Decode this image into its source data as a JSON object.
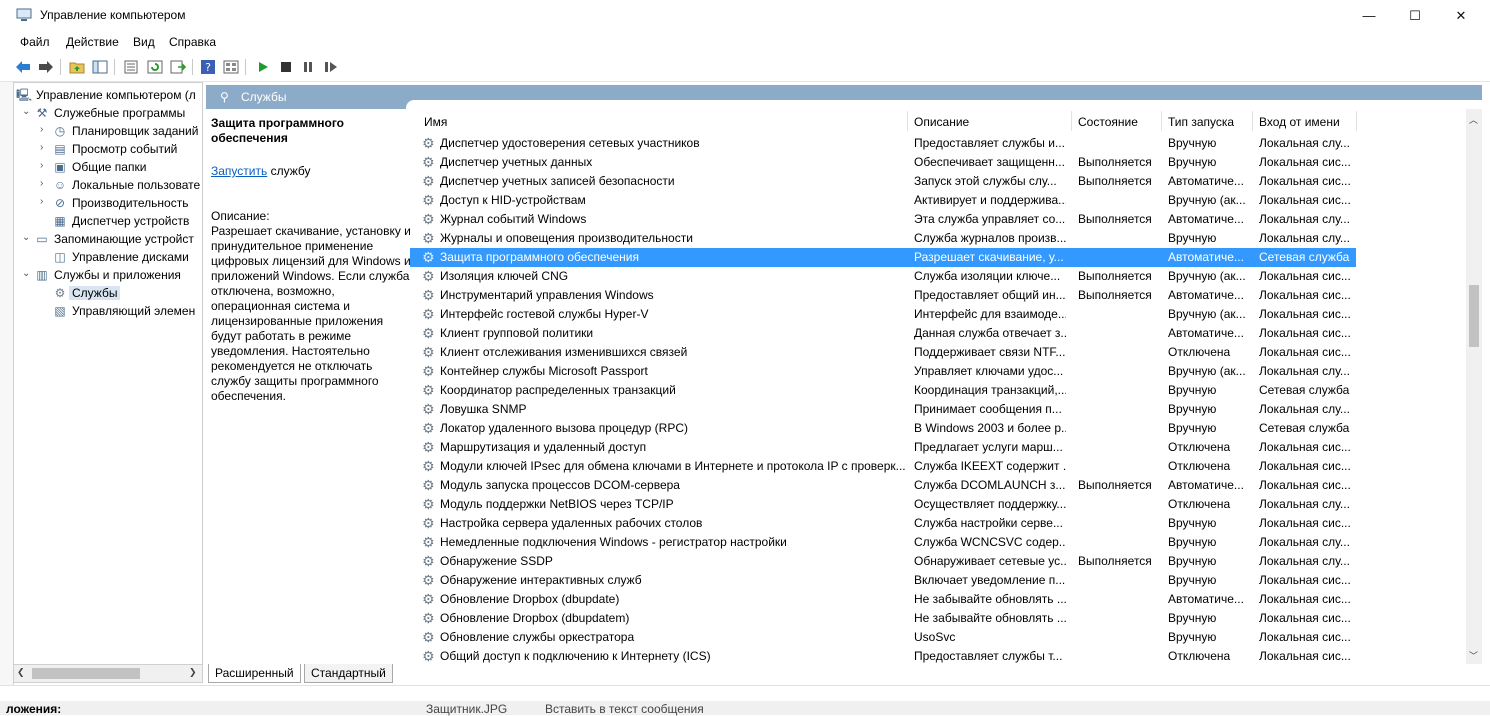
{
  "window": {
    "title": "Управление компьютером",
    "controls": {
      "minimize": "—",
      "maximize": "☐",
      "close": "✕"
    }
  },
  "menu": [
    {
      "label": "Файл"
    },
    {
      "label": "Действие"
    },
    {
      "label": "Вид"
    },
    {
      "label": "Справка"
    }
  ],
  "tree": [
    {
      "label": "Управление компьютером (л",
      "icon": "computer-icon",
      "level": 0,
      "exp": ""
    },
    {
      "label": "Служебные программы",
      "icon": "tools-icon",
      "level": 1,
      "exp": "⌄"
    },
    {
      "label": "Планировщик заданий",
      "icon": "clock-icon",
      "level": 2,
      "exp": "›"
    },
    {
      "label": "Просмотр событий",
      "icon": "event-viewer-icon",
      "level": 2,
      "exp": "›"
    },
    {
      "label": "Общие папки",
      "icon": "shared-folder-icon",
      "level": 2,
      "exp": "›"
    },
    {
      "label": "Локальные пользовате",
      "icon": "users-icon",
      "level": 2,
      "exp": "›"
    },
    {
      "label": "Производительность",
      "icon": "performance-icon",
      "level": 2,
      "exp": "›"
    },
    {
      "label": "Диспетчер устройств",
      "icon": "device-manager-icon",
      "level": 2,
      "exp": ""
    },
    {
      "label": "Запоминающие устройст",
      "icon": "storage-icon",
      "level": 1,
      "exp": "⌄"
    },
    {
      "label": "Управление дисками",
      "icon": "disk-icon",
      "level": 2,
      "exp": ""
    },
    {
      "label": "Службы и приложения",
      "icon": "services-apps-icon",
      "level": 1,
      "exp": "⌄"
    },
    {
      "label": "Службы",
      "icon": "services-icon",
      "level": 2,
      "exp": "",
      "selected": true
    },
    {
      "label": "Управляющий элемен",
      "icon": "wmi-icon",
      "level": 2,
      "exp": ""
    }
  ],
  "pane": {
    "title": "Службы"
  },
  "description": {
    "service_title": "Защита программного обеспечения",
    "start_link": "Запустить",
    "start_suffix": " службу",
    "label": "Описание:",
    "text": "Разрешает скачивание, установку и принудительное применение цифровых лицензий для Windows и приложений Windows. Если служба отключена, возможно, операционная система и лицензированные приложения будут работать в режиме уведомления. Настоятельно рекомендуется не отключать службу защиты программного обеспечения."
  },
  "columns": [
    "Имя",
    "Описание",
    "Состояние",
    "Тип запуска",
    "Вход от имени"
  ],
  "rows": [
    {
      "name": "Диспетчер удостоверения сетевых участников",
      "desc": "Предоставляет службы и...",
      "state": "",
      "start": "Вручную",
      "logon": "Локальная слу..."
    },
    {
      "name": "Диспетчер учетных данных",
      "desc": "Обеспечивает защищенн...",
      "state": "Выполняется",
      "start": "Вручную",
      "logon": "Локальная сис..."
    },
    {
      "name": "Диспетчер учетных записей безопасности",
      "desc": "Запуск этой службы слу...",
      "state": "Выполняется",
      "start": "Автоматиче...",
      "logon": "Локальная сис..."
    },
    {
      "name": "Доступ к HID-устройствам",
      "desc": "Активирует и поддержива...",
      "state": "",
      "start": "Вручную (ак...",
      "logon": "Локальная сис..."
    },
    {
      "name": "Журнал событий Windows",
      "desc": "Эта служба управляет со...",
      "state": "Выполняется",
      "start": "Автоматиче...",
      "logon": "Локальная слу..."
    },
    {
      "name": "Журналы и оповещения производительности",
      "desc": "Служба журналов произв...",
      "state": "",
      "start": "Вручную",
      "logon": "Локальная слу..."
    },
    {
      "name": "Защита программного обеспечения",
      "desc": "Разрешает скачивание, у...",
      "state": "",
      "start": "Автоматиче...",
      "logon": "Сетевая служба",
      "selected": true
    },
    {
      "name": "Изоляция ключей CNG",
      "desc": "Служба изоляции ключе...",
      "state": "Выполняется",
      "start": "Вручную (ак...",
      "logon": "Локальная сис..."
    },
    {
      "name": "Инструментарий управления Windows",
      "desc": "Предоставляет общий ин...",
      "state": "Выполняется",
      "start": "Автоматиче...",
      "logon": "Локальная сис..."
    },
    {
      "name": "Интерфейс гостевой службы Hyper-V",
      "desc": "Интерфейс для взаимоде...",
      "state": "",
      "start": "Вручную (ак...",
      "logon": "Локальная сис..."
    },
    {
      "name": "Клиент групповой политики",
      "desc": "Данная служба отвечает з...",
      "state": "",
      "start": "Автоматиче...",
      "logon": "Локальная сис..."
    },
    {
      "name": "Клиент отслеживания изменившихся связей",
      "desc": "Поддерживает связи NTF...",
      "state": "",
      "start": "Отключена",
      "logon": "Локальная сис..."
    },
    {
      "name": "Контейнер службы Microsoft Passport",
      "desc": "Управляет ключами удос...",
      "state": "",
      "start": "Вручную (ак...",
      "logon": "Локальная слу..."
    },
    {
      "name": "Координатор распределенных транзакций",
      "desc": "Координация транзакций,...",
      "state": "",
      "start": "Вручную",
      "logon": "Сетевая служба"
    },
    {
      "name": "Ловушка SNMP",
      "desc": "Принимает сообщения п...",
      "state": "",
      "start": "Вручную",
      "logon": "Локальная слу..."
    },
    {
      "name": "Локатор удаленного вызова процедур (RPC)",
      "desc": "В Windows 2003 и более р...",
      "state": "",
      "start": "Вручную",
      "logon": "Сетевая служба"
    },
    {
      "name": "Маршрутизация и удаленный доступ",
      "desc": "Предлагает услуги марш...",
      "state": "",
      "start": "Отключена",
      "logon": "Локальная сис..."
    },
    {
      "name": "Модули ключей IPsec для обмена ключами в Интернете и протокола IP с проверк...",
      "desc": "Служба IKEEXT содержит ...",
      "state": "",
      "start": "Отключена",
      "logon": "Локальная сис..."
    },
    {
      "name": "Модуль запуска процессов DCOM-сервера",
      "desc": "Служба DCOMLAUNCH з...",
      "state": "Выполняется",
      "start": "Автоматиче...",
      "logon": "Локальная сис..."
    },
    {
      "name": "Модуль поддержки NetBIOS через TCP/IP",
      "desc": "Осуществляет поддержку...",
      "state": "",
      "start": "Отключена",
      "logon": "Локальная слу..."
    },
    {
      "name": "Настройка сервера удаленных рабочих столов",
      "desc": "Служба настройки серве...",
      "state": "",
      "start": "Вручную",
      "logon": "Локальная сис..."
    },
    {
      "name": "Немедленные подключения Windows - регистратор настройки",
      "desc": "Служба WCNCSVC содер...",
      "state": "",
      "start": "Вручную",
      "logon": "Локальная слу..."
    },
    {
      "name": "Обнаружение SSDP",
      "desc": "Обнаруживает сетевые ус...",
      "state": "Выполняется",
      "start": "Вручную",
      "logon": "Локальная слу..."
    },
    {
      "name": "Обнаружение интерактивных служб",
      "desc": "Включает уведомление п...",
      "state": "",
      "start": "Вручную",
      "logon": "Локальная сис..."
    },
    {
      "name": "Обновление Dropbox (dbupdate)",
      "desc": "Не забывайте обновлять ...",
      "state": "",
      "start": "Автоматиче...",
      "logon": "Локальная сис..."
    },
    {
      "name": "Обновление Dropbox (dbupdatem)",
      "desc": "Не забывайте обновлять ...",
      "state": "",
      "start": "Вручную",
      "logon": "Локальная сис..."
    },
    {
      "name": "Обновление службы оркестратора",
      "desc": "UsoSvc",
      "state": "",
      "start": "Вручную",
      "logon": "Локальная сис..."
    },
    {
      "name": "Общий доступ к подключению к Интернету (ICS)",
      "desc": "Предоставляет службы т...",
      "state": "",
      "start": "Отключена",
      "logon": "Локальная сис..."
    }
  ],
  "bottom_tabs": [
    "Расширенный",
    "Стандартный"
  ],
  "behind": {
    "bottom_text": "ложения:",
    "attachment_name": "Защитник.JPG",
    "insert_text": "Вставить в текст сообщения"
  },
  "colors": {
    "selection": "#3399ff",
    "header_band": "#8cabc8",
    "link": "#0a5ec2"
  }
}
